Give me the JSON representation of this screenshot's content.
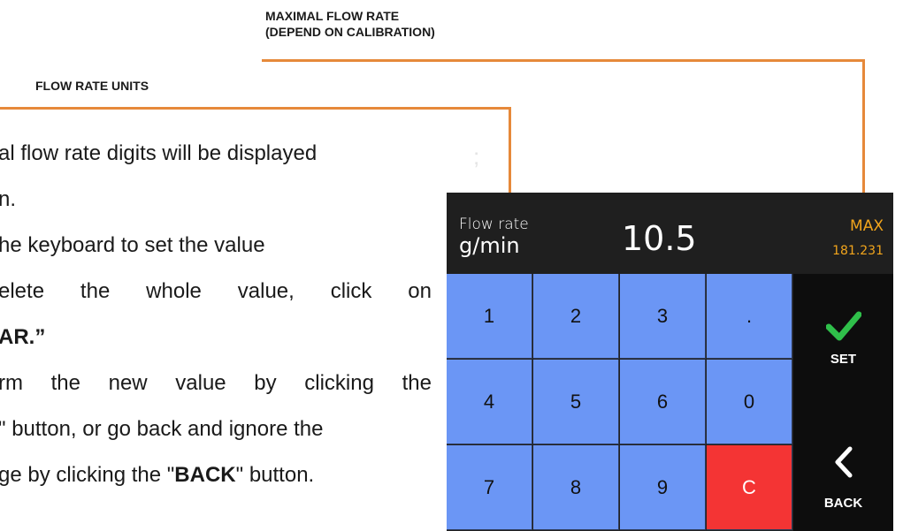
{
  "callouts": {
    "max_line1": "MAXIMAL FLOW RATE",
    "max_line2": "(DEPEND ON CALIBRATION)",
    "units": "FLOW RATE UNITS",
    "line_color": "#e6893a"
  },
  "body_text": {
    "l1": "al flow rate digits will be displayed",
    "l2": "n.",
    "l3": "he keyboard to set the value",
    "l4a": "elete",
    "l4b": "the",
    "l4c": "whole",
    "l4d": "value,",
    "l4e": "click",
    "l4f": "on",
    "l5": "AR.”",
    "l6a": "rm",
    "l6b": "the",
    "l6c": "new",
    "l6d": "value",
    "l6e": "by",
    "l6f": "clicking",
    "l6g": "the",
    "l7": "\" button, or go back and ignore the",
    "l8_pre": "ge by clicking the \"",
    "l8_bold": "BACK",
    "l8_post": "\" button.",
    "stray_mark": ";"
  },
  "device": {
    "flow_label": "Flow rate",
    "unit": "g/min",
    "value": "10.5",
    "max_label": "MAX",
    "max_value": "181.231",
    "keys": [
      "1",
      "2",
      "3",
      ".",
      "4",
      "5",
      "6",
      "0",
      "7",
      "8",
      "9",
      "C"
    ],
    "set_label": "SET",
    "back_label": "BACK",
    "colors": {
      "key": "#6b96f5",
      "clear_key": "#f43434",
      "max": "#f2a51c",
      "check": "#2fbf4a"
    }
  }
}
